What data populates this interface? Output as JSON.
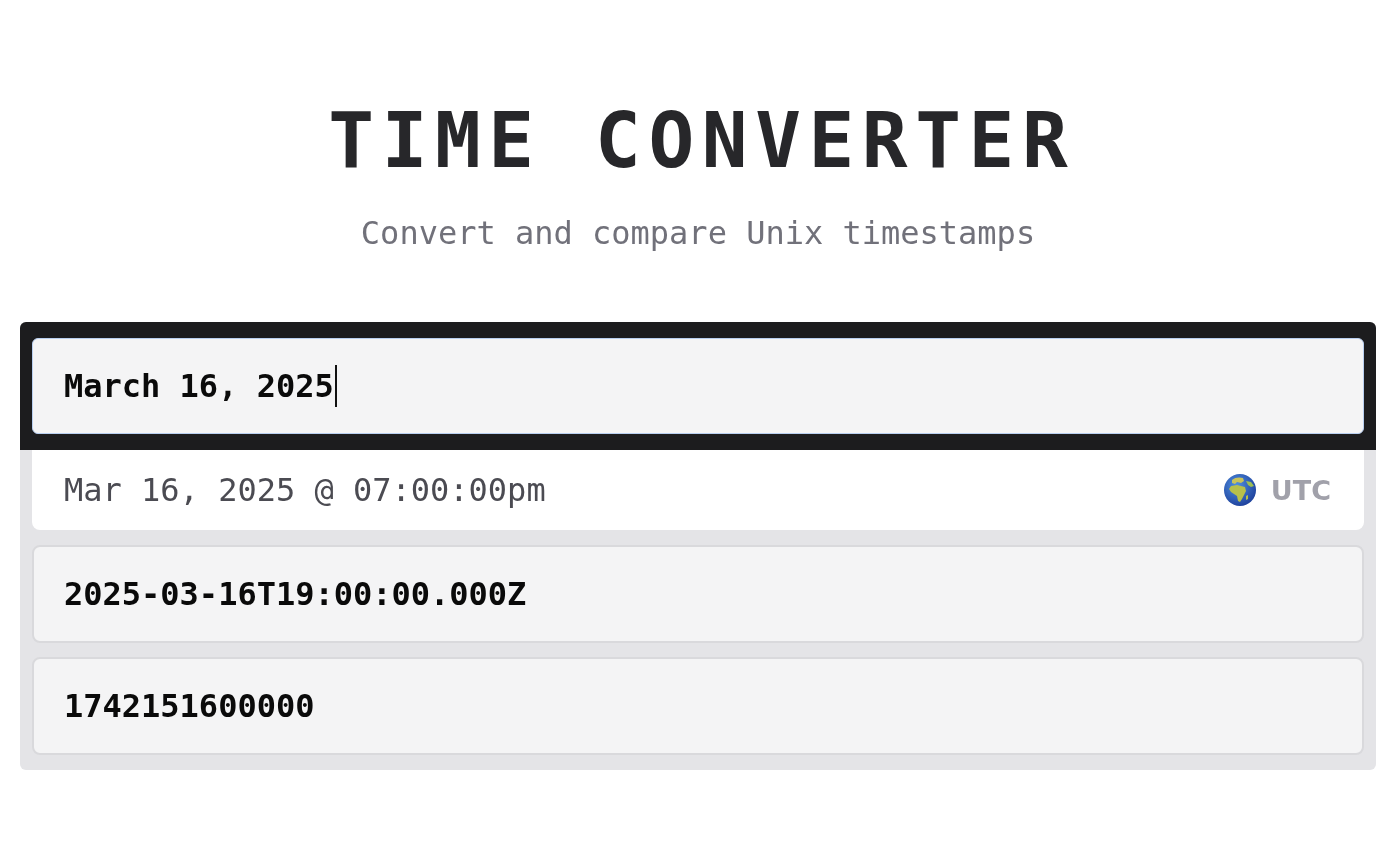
{
  "header": {
    "title": "TIME CONVERTER",
    "subtitle": "Convert and compare Unix timestamps"
  },
  "converter": {
    "input": {
      "value": "March 16, 2025",
      "focused": true
    },
    "results": [
      {
        "kind": "readable",
        "value": "Mar 16, 2025 @ 07:00:00pm",
        "timezone": "UTC"
      },
      {
        "kind": "output",
        "value": "2025-03-16T19:00:00.000Z"
      },
      {
        "kind": "output",
        "value": "1742151600000"
      }
    ]
  }
}
